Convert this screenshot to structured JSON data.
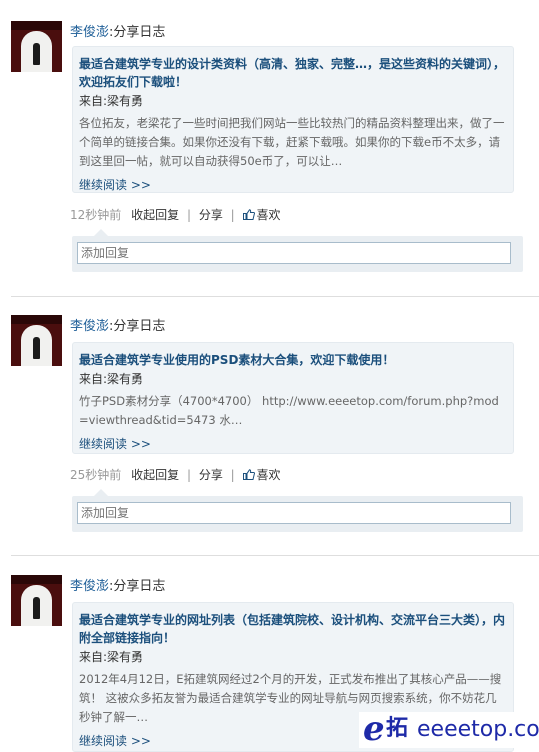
{
  "posts": [
    {
      "user": "李俊澎",
      "action": ":分享日志",
      "title": "最适合建筑学专业的设计类资料（高清、独家、完整…，是这些资料的关键词），欢迎拓友们下载啦！",
      "from": "来自:梁有勇",
      "excerpt": "各位拓友，老梁花了一些时间把我们网站一些比较热门的精品资料整理出来，做了一个简单的链接合集。如果你还没有下载，赶紧下载哦。如果你的下载e币不太多，请到这里回一帖，就可以自动获得50e币了，可以让…",
      "more": "继续阅读 >>",
      "time": "12秒钟前",
      "collect": "收起回复",
      "share": "分享",
      "like": "喜欢",
      "reply_placeholder": "添加回复"
    },
    {
      "user": "李俊澎",
      "action": ":分享日志",
      "title": "最适合建筑学专业使用的PSD素材大合集，欢迎下载使用！",
      "from": "来自:梁有勇",
      "excerpt": "竹子PSD素材分享（4700*4700） http://www.eeeetop.com/forum.php?mod=viewthread&tid=5473 水…",
      "more": "继续阅读 >>",
      "time": "25秒钟前",
      "collect": "收起回复",
      "share": "分享",
      "like": "喜欢",
      "reply_placeholder": "添加回复"
    },
    {
      "user": "李俊澎",
      "action": ":分享日志",
      "title": "最适合建筑学专业的网址列表（包括建筑院校、设计机构、交流平台三大类），内附全部链接指向！",
      "from": "来自:梁有勇",
      "excerpt": "2012年4月12日，E拓建筑网经过2个月的开发，正式发布推出了其核心产品——搜筑！ 这被众多拓友誉为最适合建筑学专业的网址导航与网页搜索系统，你不妨花几秒钟了解一…",
      "more": "继续阅读 >>"
    }
  ],
  "watermark": {
    "logo_letter": "e",
    "logo_cn": "拓",
    "site": "eeeetop.com"
  },
  "colors": {
    "link": "#1b4f7c",
    "username": "#1f5f98",
    "card_bg": "#f0f4f7",
    "reply_bg": "#e9eef2",
    "watermark": "#1e2aa8"
  }
}
